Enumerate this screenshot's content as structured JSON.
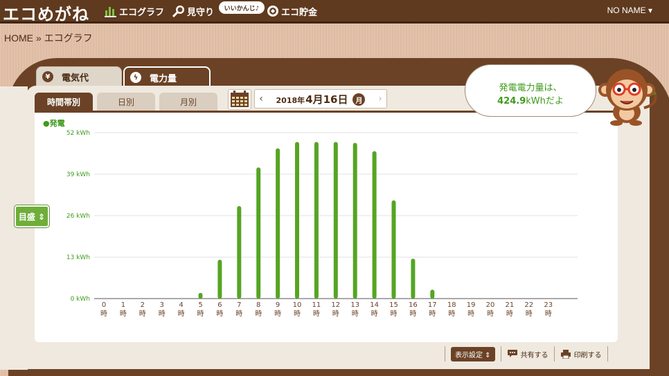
{
  "header": {
    "logo": "エコめがね",
    "nav": {
      "ecograph": "エコグラフ",
      "mimamori": "見守り",
      "mimamori_tag": "いいかんじ♪",
      "savings": "エコ貯金"
    },
    "user": "NO NAME ▾"
  },
  "breadcrumb": "HOME » エコグラフ",
  "tabs": {
    "cost": "電気代",
    "cost_icon_symbol": "¥",
    "power": "電力量",
    "power_icon_symbol": "ϟ"
  },
  "period_tabs": {
    "hourly": "時間帯別",
    "daily": "日別",
    "monthly": "月別"
  },
  "date": {
    "year": "2018年",
    "monthday": "4月16日",
    "dow": "月",
    "prev": "‹",
    "next": "›"
  },
  "speech": {
    "line1": "発電電力量は、",
    "value": "424.9",
    "line2_suffix": "kWhだよ"
  },
  "scale_button": "目盛 ⇕",
  "bottom": {
    "display_settings": "表示設定 ⇕",
    "share": "共有する",
    "print": "印刷する"
  },
  "colors": {
    "bar": "#55a523",
    "brand_brown": "#6b4226",
    "accent_green": "#3f9b1b"
  },
  "chart_data": {
    "type": "bar",
    "legend": "●発電",
    "hour_suffix": "時",
    "x": [
      "0",
      "1",
      "2",
      "3",
      "4",
      "5",
      "6",
      "7",
      "8",
      "9",
      "10",
      "11",
      "12",
      "13",
      "14",
      "15",
      "16",
      "17",
      "18",
      "19",
      "20",
      "21",
      "22",
      "23"
    ],
    "values": [
      0,
      0,
      0,
      0,
      0,
      1.8,
      12.2,
      29.0,
      41.1,
      47.1,
      49.1,
      49.1,
      49.1,
      48.8,
      46.2,
      30.8,
      12.5,
      2.8,
      0,
      0,
      0,
      0,
      0,
      0
    ],
    "y_ticks": [
      "0 kWh",
      "13 kWh",
      "26 kWh",
      "39 kWh",
      "52 kWh"
    ],
    "ylim": [
      0,
      52
    ],
    "grid": true
  }
}
